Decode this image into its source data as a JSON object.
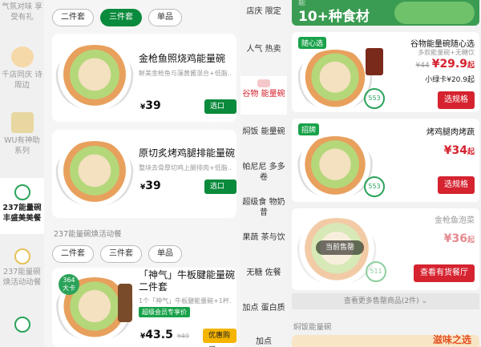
{
  "left": {
    "nav": [
      {
        "label": "气氛对味 享受有礼"
      },
      {
        "label": "千店同庆 诗周边"
      },
      {
        "label": "WU有神助 系列"
      },
      {
        "label": "237能量碗 丰盛美美餐"
      },
      {
        "label": "237能量碗 焕活动动餐"
      },
      {
        "label": ""
      }
    ],
    "chips_top": [
      "二件套",
      "三件套",
      "单品"
    ],
    "products": [
      {
        "title": "金枪鱼照烧鸡能量碗",
        "desc": "鲜美金枪鱼与藻黄酱混合+低脂...",
        "price": "39",
        "btn": "选口味"
      },
      {
        "title": "原切炙烤鸡腿排能量碗",
        "desc": "整块去骨厚切鸡上腿排肉+低脂...",
        "price": "39",
        "btn": "选口味"
      }
    ],
    "section": "237能量碗焕活动餐",
    "chips_mid": [
      "二件套",
      "三件套",
      "单品"
    ],
    "bottom": {
      "title": "「神气」牛板腱能量碗二件套",
      "desc": "1个「神气」牛板腱能量碗+1杯...",
      "badge_value": "364",
      "badge_unit": "大卡",
      "promo": "超级会员专享价",
      "price": "43.5",
      "old_price": "¥49",
      "btn": "优惠购买"
    }
  },
  "right": {
    "nav": [
      {
        "label": "店庆 限定"
      },
      {
        "label": "人气 热卖"
      },
      {
        "label": "谷物 能量碗"
      },
      {
        "label": "焖饭 能量碗"
      },
      {
        "label": "帕尼尼 多多卷"
      },
      {
        "label": "超级食 物奶昔"
      },
      {
        "label": "果蔬 茶与饮"
      },
      {
        "label": "无糖 佐餐"
      },
      {
        "label": "加点 蛋白质"
      },
      {
        "label": "加点"
      }
    ],
    "banner": "10+种食材",
    "banner_sub": "能",
    "items": [
      {
        "tag": "随心选",
        "title": "谷物能量碗随心选",
        "sub": "多款能量碗+无糖饮",
        "old": "¥44",
        "price": "29.9",
        "price_suffix": "起",
        "card": "小绿卡¥20.9起",
        "kcal": "553",
        "btn": "选规格"
      },
      {
        "tag": "招牌",
        "title": "烤鸡腿肉烤蔬",
        "sub": "",
        "old": "",
        "price": "34",
        "price_suffix": "起",
        "card": "",
        "kcal": "553",
        "btn": "选规格"
      },
      {
        "tag": "",
        "title": "金枪鱼泡菜",
        "sub": "",
        "old": "",
        "price": "36",
        "price_suffix": "起",
        "card": "",
        "kcal": "511",
        "btn": "查看有货餐厅",
        "overlay": "当前售罄"
      }
    ],
    "more": "查看更多售罄商品(2件)",
    "section2": "焖饭能量碗",
    "promo_bottom": "滋味之选"
  }
}
